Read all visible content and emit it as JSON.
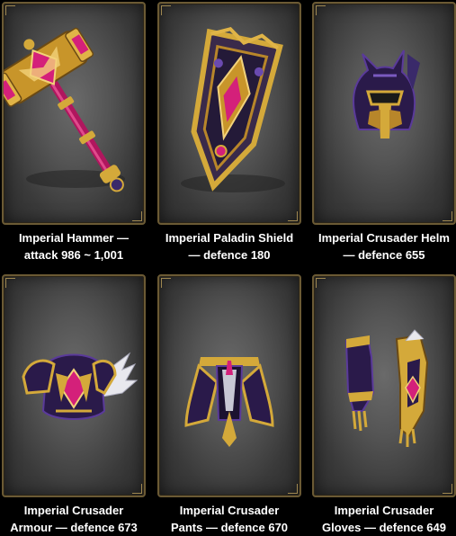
{
  "items": [
    {
      "line1": "Imperial Hammer —",
      "line2": "attack 986 ~ 1,001",
      "icon": "hammer-icon"
    },
    {
      "line1": "Imperial Paladin Shield",
      "line2": "— defence 180",
      "icon": "shield-icon"
    },
    {
      "line1": "Imperial Crusader Helm",
      "line2": "— defence 655",
      "icon": "helm-icon"
    },
    {
      "line1": "Imperial Crusader",
      "line2": "Armour — defence 673",
      "icon": "armour-icon"
    },
    {
      "line1": "Imperial Crusader",
      "line2": "Pants — defence 670",
      "icon": "pants-icon"
    },
    {
      "line1": "Imperial Crusader",
      "line2": "Gloves — defence 649",
      "icon": "gloves-icon"
    }
  ],
  "colors": {
    "gold": "#d4a93a",
    "purple": "#2a1a4a",
    "magenta": "#d4207a",
    "frame": "#6b5a34"
  }
}
